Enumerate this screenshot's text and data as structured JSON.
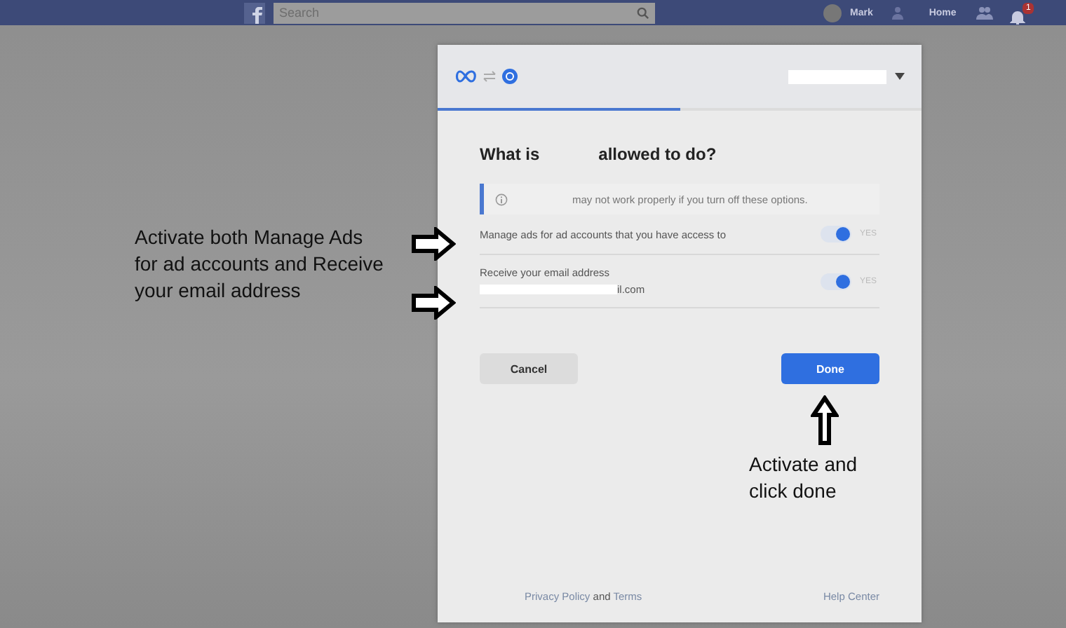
{
  "top_bar": {
    "search": {
      "placeholder": "Search"
    },
    "user_name": "Mark",
    "home_label": "Home",
    "notification_count": "1"
  },
  "dialog": {
    "progress": {
      "level": 0.5
    },
    "heading_start": "What is",
    "heading_end": "allowed to do?",
    "notice": "may not work properly if you turn off these options.",
    "permissions": [
      {
        "label": "Manage ads for ad accounts that you have access to",
        "on": true,
        "state_label": "YES"
      },
      {
        "label": "Receive your email address",
        "detail": "il.com",
        "on": true,
        "state_label": "YES"
      }
    ],
    "buttons": [
      {
        "label": "Cancel",
        "kind": "secondary"
      },
      {
        "label": "Done",
        "kind": "primary"
      }
    ],
    "footer": {
      "privacy_link": "Privacy Policy",
      "joiner": "and",
      "terms_link": "Terms",
      "help_link": "Help Center"
    }
  },
  "annotations": [
    {
      "text": "Activate both Manage Ads for ad accounts and Receive your email address",
      "kind": "left"
    },
    {
      "text": "Activate and click done",
      "kind": "up"
    }
  ]
}
